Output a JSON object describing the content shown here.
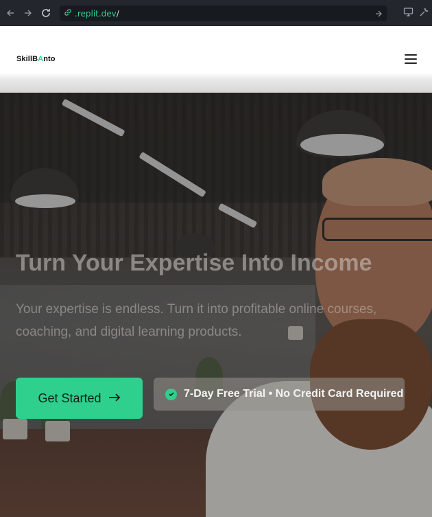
{
  "browser": {
    "url_host": ".replit.dev",
    "url_path": "/"
  },
  "header": {
    "logo_part1": "SkillB",
    "logo_accent": "A",
    "logo_part2": "nto"
  },
  "hero": {
    "title": "Turn Your Expertise Into Income",
    "subtitle": "Your expertise is endless. Turn it into profitable online courses, coaching, and digital learning products.",
    "cta_label": "Get Started",
    "trial_text": "7-Day Free Trial • No Credit Card Required"
  },
  "colors": {
    "accent": "#2fd08e",
    "header_bg": "#ffffff",
    "browser_bar": "#23262d"
  },
  "icons": [
    "back-arrow-icon",
    "forward-arrow-icon",
    "reload-icon",
    "link-icon",
    "go-arrow-icon",
    "monitor-icon",
    "wrench-icon",
    "hamburger-menu-icon",
    "arrow-right-icon",
    "check-circle-icon"
  ]
}
